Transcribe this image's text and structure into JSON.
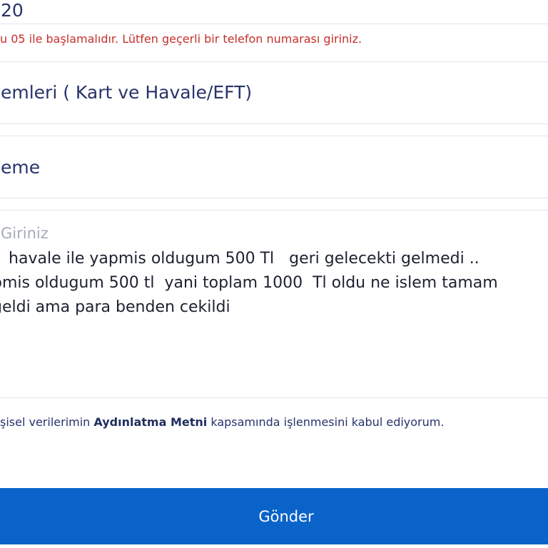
{
  "form": {
    "phone": {
      "value": "20"
    },
    "phone_error": "u 05 ile başlamalıdır. Lütfen geçerli bir telefon numarası giriniz.",
    "category": {
      "value": "emleri ( Kart ve Havale/EFT)"
    },
    "subject": {
      "value": "eme"
    },
    "message": {
      "label": "Giriniz",
      "value": "r  havale ile yapmis oldugum 500 Tl   geri gelecekti gelmedi ..\npmis oldugum 500 tl  yani toplam 1000  Tl oldu ne islem tamam\ngeldi ama para benden cekildi"
    },
    "consent": {
      "prefix": "şisel verilerimin ",
      "link_text": "Aydınlatma Metni",
      "suffix": " kapsamında işlenmesini kabul ediyorum."
    },
    "submit_label": "Gönder"
  },
  "colors": {
    "accent": "#0a63c9",
    "error": "#c5302a",
    "text_navy": "#27336b",
    "border": "#e3e5ea"
  }
}
